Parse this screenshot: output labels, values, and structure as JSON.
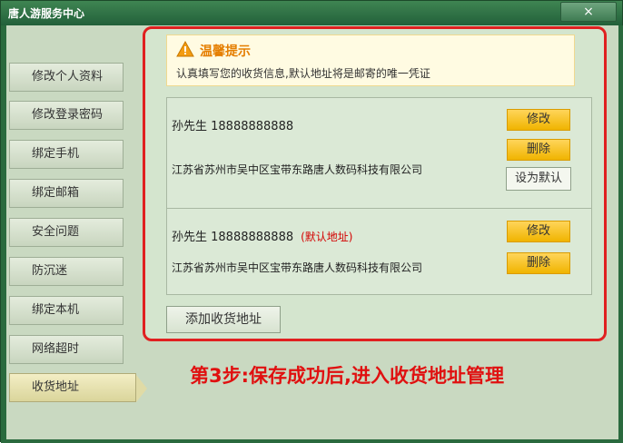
{
  "window": {
    "title": "唐人游服务中心",
    "close_glyph": "×"
  },
  "sidebar": {
    "items": [
      {
        "label": "修改个人资料"
      },
      {
        "label": "修改登录密码"
      },
      {
        "label": "绑定手机"
      },
      {
        "label": "绑定邮箱"
      },
      {
        "label": "安全问题"
      },
      {
        "label": "防沉迷"
      },
      {
        "label": "绑定本机"
      },
      {
        "label": "网络超时"
      },
      {
        "label": "收货地址",
        "active": true
      }
    ]
  },
  "tip": {
    "icon": "warning-icon",
    "title": "温馨提示",
    "text": "认真填写您的收货信息,默认地址将是邮寄的唯一凭证"
  },
  "addresses": [
    {
      "name_phone": "孙先生 18888888888",
      "default_tag": "",
      "address": "江苏省苏州市吴中区宝带东路唐人数码科技有限公司",
      "edit_label": "修改",
      "delete_label": "删除",
      "set_default_label": "设为默认"
    },
    {
      "name_phone": "孙先生 18888888888",
      "default_tag": "(默认地址)",
      "address": "江苏省苏州市吴中区宝带东路唐人数码科技有限公司",
      "edit_label": "修改",
      "delete_label": "删除"
    }
  ],
  "add_button": "添加收货地址",
  "step_caption": "第3步:保存成功后,进入收货地址管理",
  "colors": {
    "accent": "#e02020",
    "window": "#2a6a3e",
    "panel": "#c9d9c1",
    "button": "#f0b400"
  }
}
